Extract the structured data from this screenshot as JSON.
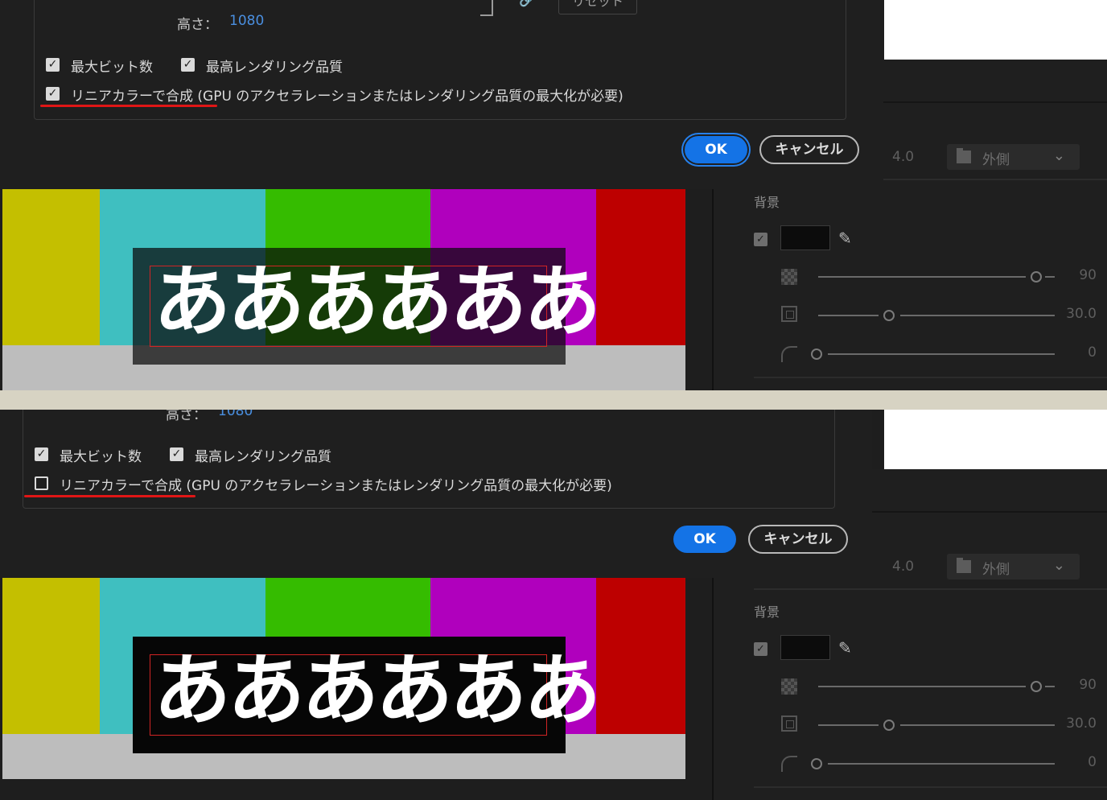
{
  "dialog": {
    "height_label": "高さ：",
    "height_value": "1080",
    "reset_label": "リセット",
    "opt_max_bit": "最大ビット数",
    "opt_max_quality": "最高レンダリング品質",
    "opt_linear": "リニアカラーで合成 (GPU のアクセラレーションまたはレンダリング品質の最大化が必要)",
    "ok_label": "OK",
    "cancel_label": "キャンセル"
  },
  "panel": {
    "size_value": "4.0",
    "position_select": "外側",
    "background_label": "背景",
    "opacity_value": "90",
    "size2_value": "30.0",
    "corner_value": "0"
  },
  "video": {
    "text": "ああああああ",
    "bar_colors": [
      "#c4bf00",
      "#3fbfc0",
      "#35bc00",
      "#b000bd",
      "#bd0000"
    ]
  },
  "states": {
    "top": {
      "linear_checked": true,
      "ok_focused": true
    },
    "bottom": {
      "linear_checked": false,
      "ok_focused": false
    }
  }
}
